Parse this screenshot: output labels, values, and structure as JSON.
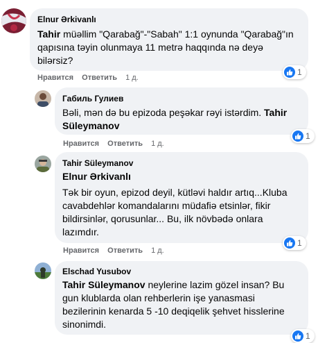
{
  "comments": [
    {
      "author": "Elnur Ərkivanlı",
      "mention": "Tahir",
      "text": " müəllim \"Qarabağ\"-\"Sabah\" 1:1 oynunda \"Qarabağ\"ın qapısına təyin olunmaya 11 metrə haqqında nə deyə bilərsiz?",
      "reaction_count": "1",
      "reaction_icon": "like-icon",
      "actions": {
        "like": "Нравится",
        "reply": "Ответить",
        "time": "1 д."
      }
    },
    {
      "author": "Габиль Гулиев",
      "text": "Bəli, mən də bu epizoda peşəkar rəyi istərdim. ",
      "mention": "Tahir Süleymanov",
      "reaction_count": "1",
      "reaction_icon": "like-icon",
      "actions": {
        "like": "Нравится",
        "reply": "Ответить",
        "time": "1 д."
      }
    },
    {
      "author": "Tahir Süleymanov",
      "mention": "Elnur Ərkivanlı",
      "text": "Tək bir oyun, epizod deyil, kütləvi haldır artıq...Kluba cavabdehlər komandalarını müdafiə etsinlər, fikir bildirsinlər, qorusunlar... Bu, ilk növbədə onlara lazımdır.",
      "reaction_count": "1",
      "reaction_icon": "like-icon",
      "actions": {
        "like": "Нравится",
        "reply": "Ответить",
        "time": "1 д."
      }
    },
    {
      "author": "Elschad Yusubov",
      "mention": "Tahir Süleymanov",
      "text": " neylerine lazim gözel insan? Bu gun klublarda olan rehberlerin işe yanasmasi bezilerinin kenarda 5 -10 deqiqelik şehvet hisslerine sinonimdi.",
      "reaction_count": "1",
      "reaction_icon": "like-icon"
    }
  ],
  "colors": {
    "bubble": "#f0f2f5",
    "like_blue": "#1877f2",
    "meta_gray": "#65676b",
    "text": "#050505"
  }
}
